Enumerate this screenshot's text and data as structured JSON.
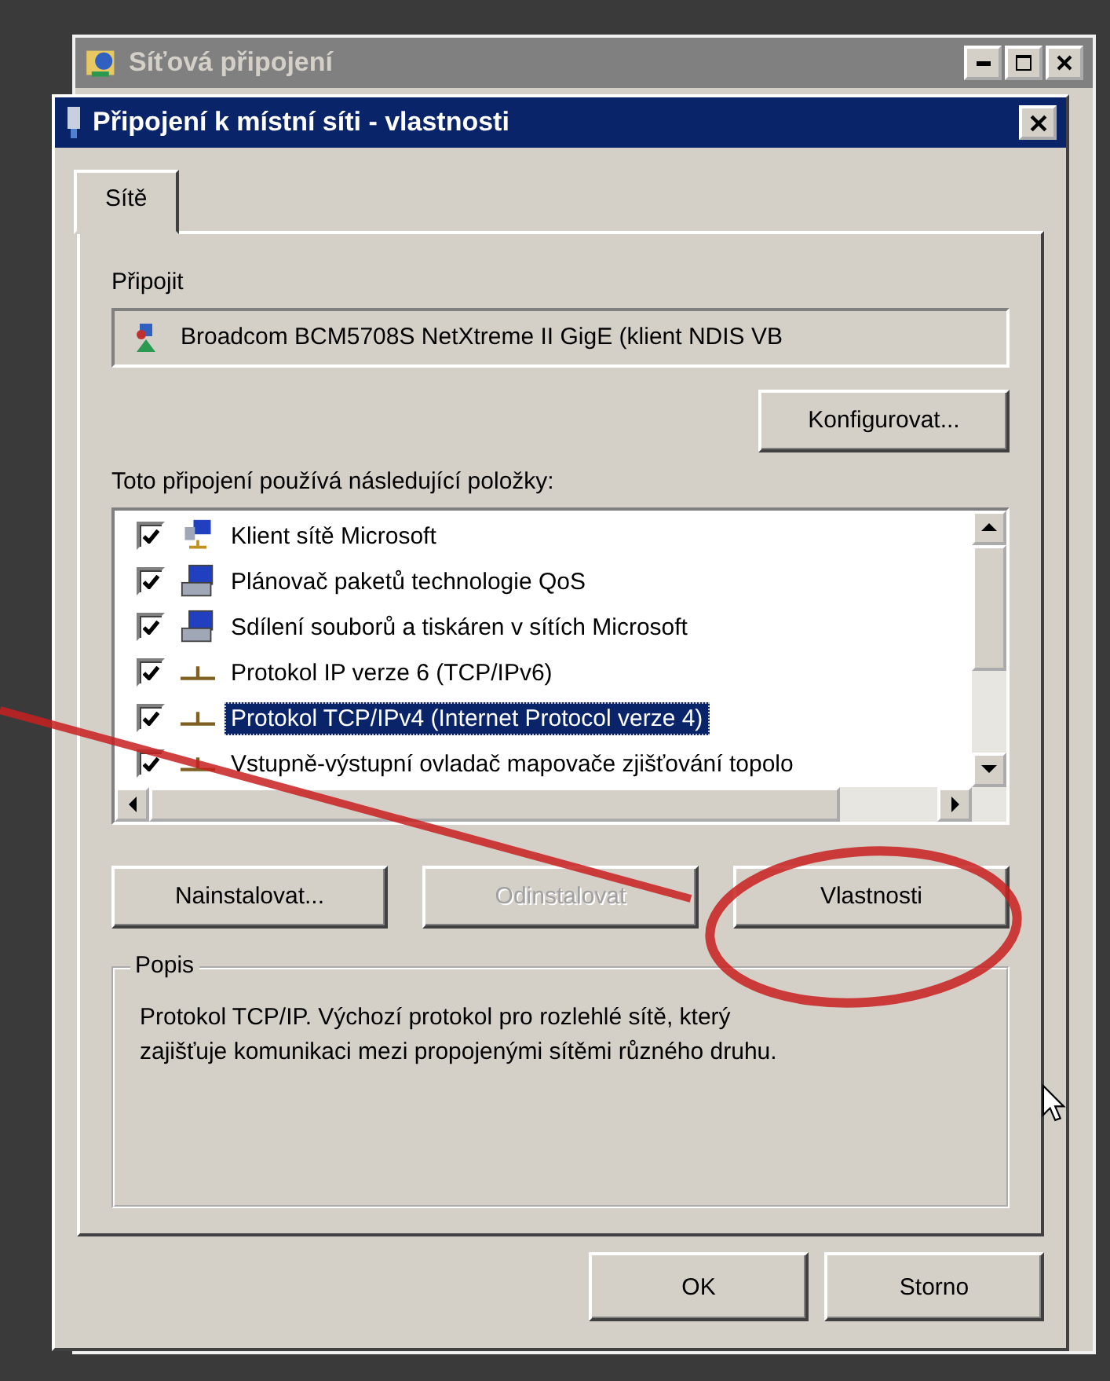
{
  "background_window": {
    "title": "Síťová připojení"
  },
  "dialog": {
    "title": "Připojení k místní síti - vlastnosti"
  },
  "tabs": [
    {
      "label": "Sítě",
      "selected": true
    }
  ],
  "connect_label": "Připojit",
  "adapter": "Broadcom BCM5708S NetXtreme II GigE (klient NDIS VB",
  "configure_button": "Konfigurovat...",
  "items_label": "Toto připojení používá následující položky:",
  "items": [
    {
      "label": "Klient sítě Microsoft",
      "checked": true,
      "selected": false,
      "kind": "client"
    },
    {
      "label": "Plánovač paketů technologie QoS",
      "checked": true,
      "selected": false,
      "kind": "service"
    },
    {
      "label": "Sdílení souborů a tiskáren v sítích Microsoft",
      "checked": true,
      "selected": false,
      "kind": "service"
    },
    {
      "label": "Protokol IP verze 6 (TCP/IPv6)",
      "checked": true,
      "selected": false,
      "kind": "protocol"
    },
    {
      "label": "Protokol TCP/IPv4 (Internet Protocol verze 4)",
      "checked": true,
      "selected": true,
      "kind": "protocol"
    },
    {
      "label": "Vstupně-výstupní ovladač mapovače zjišťování topolo",
      "checked": true,
      "selected": false,
      "kind": "protocol"
    }
  ],
  "buttons": [
    {
      "label": "Nainstalovat...",
      "disabled": false
    },
    {
      "label": "Odinstalovat",
      "disabled": true
    },
    {
      "label": "Vlastnosti",
      "disabled": false
    }
  ],
  "description": {
    "title": "Popis",
    "text": "Protokol TCP/IP. Výchozí protokol pro rozlehlé sítě, který zajišťuje komunikaci mezi propojenými sítěmi různého druhu."
  },
  "footer_buttons": [
    "OK",
    "Storno"
  ]
}
